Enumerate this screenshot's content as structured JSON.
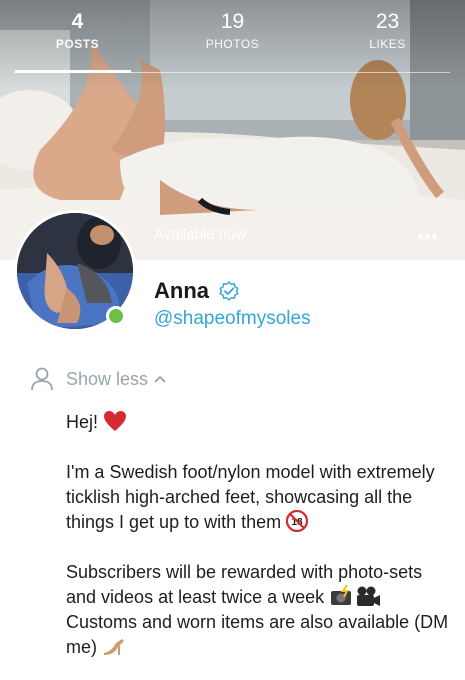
{
  "stats": [
    {
      "count": "4",
      "label": "POSTS",
      "active": true
    },
    {
      "count": "19",
      "label": "PHOTOS",
      "active": false
    },
    {
      "count": "23",
      "label": "LIKES",
      "active": false
    }
  ],
  "cover": {
    "status_text": "Available now",
    "more_icon": "ellipsis-icon"
  },
  "profile": {
    "name": "Anna",
    "handle": "@shapeofmysoles",
    "verified": true,
    "online": true,
    "accent_color": "#35a5d6",
    "online_color": "#6cc04a"
  },
  "bio": {
    "toggle_label": "Show less",
    "greeting": "Hej!",
    "paragraph_1": "I'm a Swedish foot/nylon model with extremely ticklish high-arched feet, showcasing all the things I get up to with them",
    "paragraph_2_line_1": "Subscribers will be rewarded with photo-sets and videos at least twice a week",
    "paragraph_2_line_2": "Customs and worn items are also available (DM me)"
  }
}
